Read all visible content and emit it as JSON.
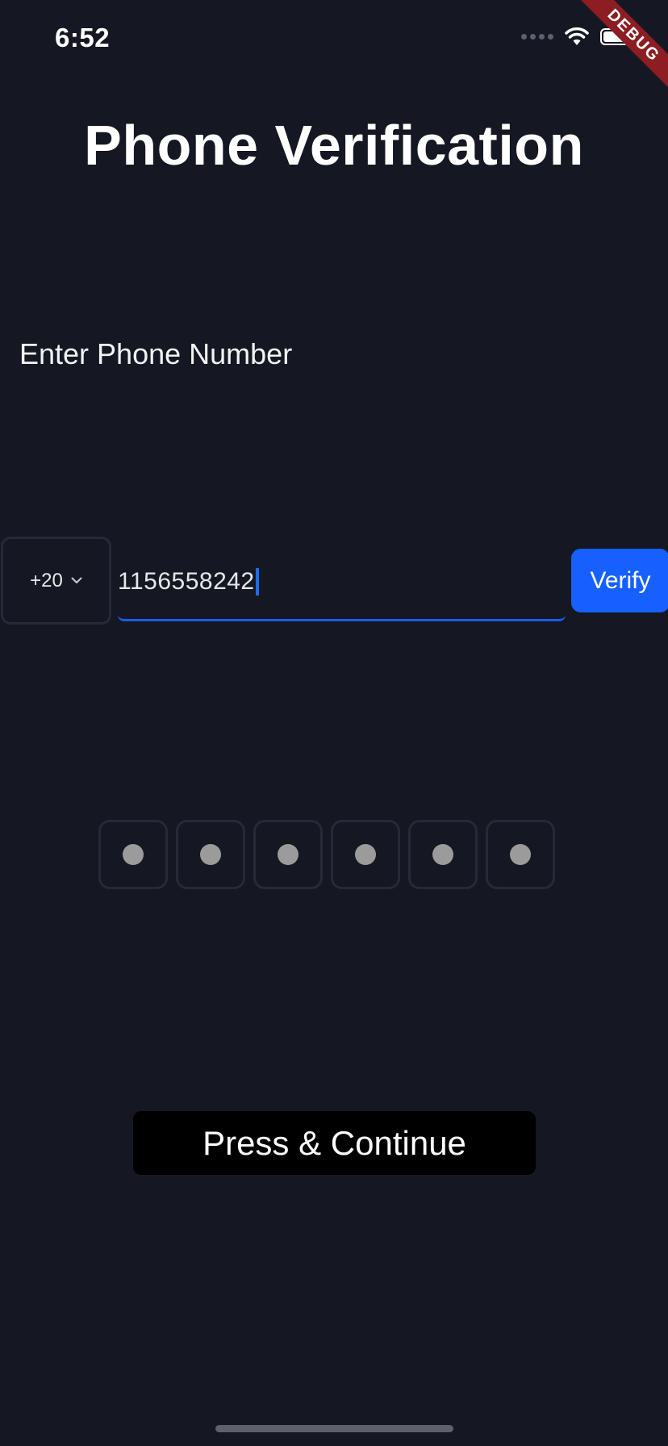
{
  "status_bar": {
    "time": "6:52",
    "icons": [
      "cellular-signal-icon",
      "wifi-icon",
      "battery-icon"
    ]
  },
  "debug_banner": {
    "label": "DEBUG",
    "color": "#8c1d22"
  },
  "page": {
    "title": "Phone Verification",
    "phone_label": "Enter Phone Number"
  },
  "phone_form": {
    "country_code": "+20",
    "country_dropdown_icon": "chevron-down-icon",
    "phone_number": "1156558242",
    "verify_label": "Verify"
  },
  "otp": {
    "digits": [
      "",
      "",
      "",
      "",
      "",
      ""
    ],
    "placeholder_glyph": "dot"
  },
  "actions": {
    "continue_label": "Press & Continue"
  },
  "colors": {
    "background": "#151822",
    "accent": "#1660ff",
    "input_border": "#262a36",
    "continue_button": "#000000"
  }
}
